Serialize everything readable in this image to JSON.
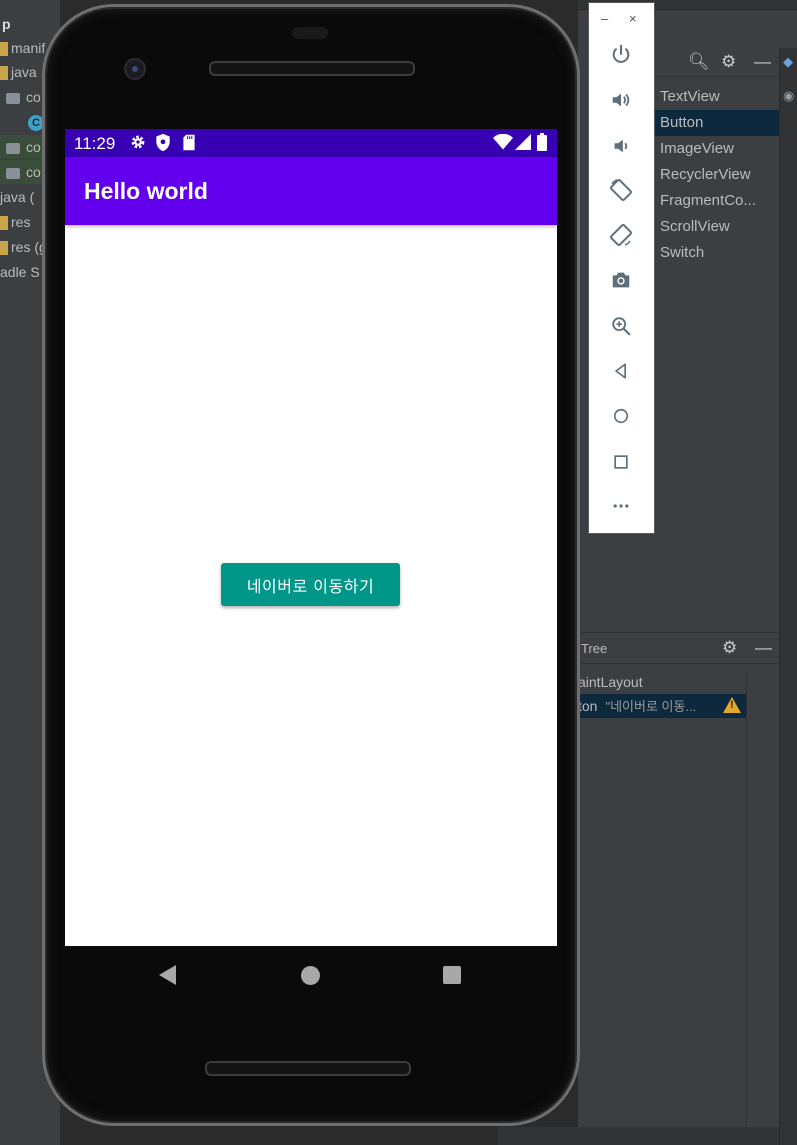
{
  "project_tree": {
    "root_label": "p",
    "items": [
      {
        "label": "manif"
      },
      {
        "label": "java"
      },
      {
        "label": "co"
      },
      {
        "label": "C"
      },
      {
        "label": "co"
      },
      {
        "label": "co"
      },
      {
        "label": "java ("
      },
      {
        "label": "res"
      },
      {
        "label": "res (g"
      },
      {
        "label": "adle S"
      }
    ]
  },
  "palette": {
    "items": [
      {
        "label": "TextView"
      },
      {
        "label": "Button",
        "selected": true
      },
      {
        "label": "ImageView"
      },
      {
        "label": "RecyclerView"
      },
      {
        "label": "FragmentCo..."
      },
      {
        "label": "ScrollView"
      },
      {
        "label": "Switch"
      }
    ]
  },
  "component_tree": {
    "title": "Tree",
    "rows": [
      {
        "label": "aintLayout"
      },
      {
        "label": "ton",
        "hint": "\"네이버로 이동...",
        "selected": true,
        "warning": true
      }
    ]
  },
  "emulator_toolbar": {
    "minimize": "–",
    "close": "×",
    "buttons": [
      "power-icon",
      "volume-up-icon",
      "volume-down-icon",
      "rotate-left-icon",
      "rotate-right-icon",
      "camera-icon",
      "zoom-icon",
      "back-icon",
      "home-icon",
      "overview-icon",
      "more-icon"
    ]
  },
  "device": {
    "status_time": "11:29",
    "status_color": "#3700b3",
    "appbar_color": "#6200ee",
    "app_title": "Hello world",
    "button_label": "네이버로 이동하기",
    "button_color": "#009688"
  }
}
